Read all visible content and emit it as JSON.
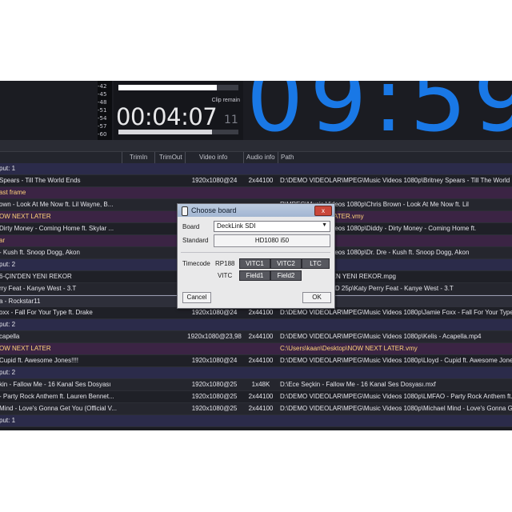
{
  "meter": {
    "labels": [
      "-42",
      "-45",
      "-48",
      "-51",
      "-54",
      "-57",
      "-60"
    ]
  },
  "timer": {
    "clip_remain_label": "Clip remain",
    "clip_remain": "00:04:07",
    "frames": "11",
    "top_bar_fraction": 0.82,
    "bottom_bar_fraction": 0.78
  },
  "big_clock": "09:59",
  "table": {
    "columns": {
      "trim_in": "TrimIn",
      "trim_out": "TrimOut",
      "video_info": "Video info",
      "audio_info": "Audio info",
      "path": "Path"
    },
    "rows": [
      {
        "kind": "grp",
        "title": "put: 1",
        "video": "",
        "audio": "",
        "path": ""
      },
      {
        "kind": "clip",
        "title": "Spears - Till The World Ends",
        "video": "1920x1080@24",
        "audio": "2x44100",
        "path": "D:\\DEMO VIDEOLAR\\MPEG\\Music Videos 1080p\\Britney Spears - Till The World Ends"
      },
      {
        "kind": "ev",
        "title": "ast frame",
        "video": "",
        "audio": "",
        "path": ""
      },
      {
        "kind": "clip",
        "title": "own - Look At Me Now ft. Lil Wayne, B...",
        "video": "",
        "audio": "",
        "path": "R\\MPEG\\Music Videos 1080p\\Chris Brown - Look At Me Now ft. Lil"
      },
      {
        "kind": "ev",
        "title": "OW NEXT LATER",
        "video": "",
        "audio": "",
        "path": "ktop\\NOW NEXT LATER.vmy"
      },
      {
        "kind": "clip",
        "title": "Dirty Money - Coming Home ft. Skylar ...",
        "video": "",
        "audio": "",
        "path": "R\\MPEG\\Music Videos 1080p\\Diddy - Dirty Money - Coming Home ft."
      },
      {
        "kind": "ev",
        "title": "ar",
        "video": "",
        "audio": "",
        "path": ""
      },
      {
        "kind": "clip",
        "title": "- Kush ft. Snoop Dogg, Akon",
        "video": "",
        "audio": "",
        "path": "R\\MPEG\\Music Videos 1080p\\Dr. Dre - Kush ft. Snoop Dogg, Akon"
      },
      {
        "kind": "grp",
        "title": "put: 2",
        "video": "",
        "audio": "",
        "path": ""
      },
      {
        "kind": "clip",
        "title": "6-ÇIN'DEN YENI REKOR",
        "video": "",
        "audio": "",
        "path": "R\\(REK) 26-ÇIN'DEN YENI REKOR.mpg"
      },
      {
        "kind": "clip",
        "title": "rry Feat  - Kanye West - 3.T",
        "video": "",
        "audio": "",
        "path": "R\\MPEG\\HD Klip\\HD 25p\\Katy Perry Feat  - Kanye West - 3.T"
      },
      {
        "kind": "sel",
        "title": "a - Rockstar11",
        "video": "",
        "audio": "",
        "path": "tar11.mpg"
      },
      {
        "kind": "clip",
        "title": "oxx - Fall For Your Type ft. Drake",
        "video": "1920x1080@24",
        "audio": "2x44100",
        "path": "D:\\DEMO VIDEOLAR\\MPEG\\Music Videos 1080p\\Jamie Foxx - Fall For Your Type ft"
      },
      {
        "kind": "grp",
        "title": "put: 2",
        "video": "",
        "audio": "",
        "path": ""
      },
      {
        "kind": "clip",
        "title": "capella",
        "video": "1920x1080@23,98",
        "audio": "2x44100",
        "path": "D:\\DEMO VIDEOLAR\\MPEG\\Music Videos 1080p\\Kelis - Acapella.mp4"
      },
      {
        "kind": "ev",
        "title": "OW NEXT LATER",
        "video": "",
        "audio": "",
        "path": "C:\\Users\\kaan\\Desktop\\NOW NEXT LATER.vmy"
      },
      {
        "kind": "clip",
        "title": "Cupid ft. Awesome Jones!!!!",
        "video": "1920x1080@24",
        "audio": "2x44100",
        "path": "D:\\DEMO VIDEOLAR\\MPEG\\Music Videos 1080p\\Lloyd - Cupid ft. Awesome Jones"
      },
      {
        "kind": "grp",
        "title": "put: 2",
        "video": "",
        "audio": "",
        "path": ""
      },
      {
        "kind": "clip",
        "title": "kin - Fallow Me - 16 Kanal Ses Dosyası",
        "video": "1920x1080@25",
        "audio": "1x48K",
        "path": "D:\\Ece Seçkin - Fallow Me - 16 Kanal Ses Dosyası.mxf"
      },
      {
        "kind": "clip",
        "title": "- Party Rock Anthem ft. Lauren Bennet...",
        "video": "1920x1080@25",
        "audio": "2x44100",
        "path": "D:\\DEMO VIDEOLAR\\MPEG\\Music Videos 1080p\\LMFAO - Party Rock Anthem ft."
      },
      {
        "kind": "clip",
        "title": "Mind - Love's Gonna Get You (Official V...",
        "video": "1920x1080@25",
        "audio": "2x44100",
        "path": "D:\\DEMO VIDEOLAR\\MPEG\\Music Videos 1080p\\Michael Mind - Love's Gonna Get Yo"
      },
      {
        "kind": "grp",
        "title": "put: 1",
        "video": "",
        "audio": "",
        "path": ""
      }
    ]
  },
  "dialog": {
    "title": "Choose board",
    "close": "x",
    "board_label": "Board",
    "board_value": "DeckLink SDI",
    "standard_label": "Standard",
    "standard_value": "HD1080 i50",
    "timecode_label": "Timecode",
    "rp188_label": "RP188",
    "vitc1": "VITC1",
    "vitc2": "VITC2",
    "ltc": "LTC",
    "vitc_label": "VITC",
    "field1": "Field1",
    "field2": "Field2",
    "cancel": "Cancel",
    "ok": "OK"
  }
}
